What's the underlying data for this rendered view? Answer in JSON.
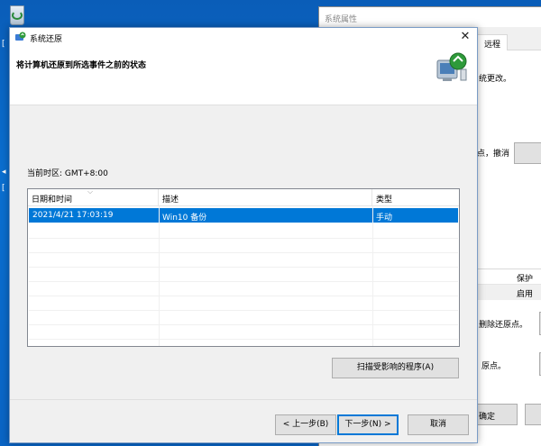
{
  "back_window": {
    "title": "系统属性",
    "tab_label": "远程",
    "text_changes": "统更改。",
    "text_undo": "点，撤消",
    "list_header": "保护",
    "list_row": "启用",
    "text_delete": "删除还原点。",
    "text_restore": "原点。",
    "ok_label": "确定"
  },
  "dialog": {
    "title": "系统还原",
    "heading": "将计算机还原到所选事件之前的状态",
    "timezone": "当前时区: GMT+8:00",
    "columns": [
      "日期和时间",
      "描述",
      "类型"
    ],
    "rows": [
      {
        "date": "2021/4/21 17:03:19",
        "description": "Win10 备份",
        "type": "手动",
        "selected": true
      }
    ],
    "scan_button": "扫描受影响的程序(A)",
    "back_button": "< 上一步(B)",
    "next_button": "下一步(N) >",
    "cancel_button": "取消"
  },
  "icons": {
    "close": "close-icon",
    "app": "system-restore-icon",
    "logo": "system-restore-logo-icon",
    "recycle": "recycle-bin-icon"
  },
  "colors": {
    "selection": "#0078d7",
    "desktop": "#0a6fd0"
  }
}
